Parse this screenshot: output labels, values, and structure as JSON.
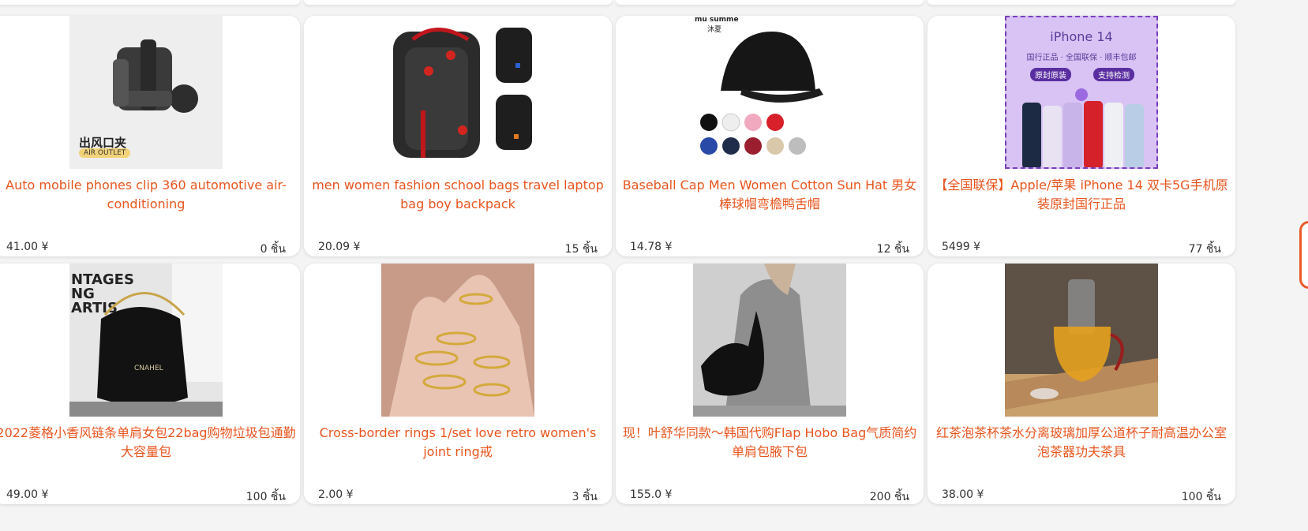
{
  "products": [
    {
      "title": "Auto mobile phones clip 360 automotive air-conditioning",
      "price": "41.00 ¥",
      "qty": "0 ชิ้น",
      "image": {
        "overlay": "出风口夹",
        "badge": "AIR OUTLET"
      }
    },
    {
      "title": "men women fashion school bags travel laptop bag boy backpack",
      "price": "20.09 ¥",
      "qty": "15 ชิ้น",
      "image": {}
    },
    {
      "title": "Baseball Cap Men Women Cotton Sun Hat 男女棒球帽弯檐鸭舌帽",
      "price": "14.78 ¥",
      "qty": "12 ชิ้น",
      "image": {
        "corner_text": "mu summe",
        "corner_sub": "沐夏"
      }
    },
    {
      "title": "【全国联保】Apple/苹果 iPhone 14 双卡5G手机原装原封国行正品",
      "price": "5499 ¥",
      "qty": "77 ชิ้น",
      "image": {
        "heading": "iPhone 14",
        "tagline": "国行正品 · 全国联保 · 顺丰包邮",
        "badge1": "原封原装",
        "badge2": "支持检测"
      }
    },
    {
      "title": "2022菱格小香风链条单肩女包22bag购物垃圾包通勤大容量包",
      "price": "49.00 ¥",
      "qty": "100 ชิ้น",
      "image": {
        "wall_text": "NTAGES NG ARTIS",
        "bag_text": "CNAHEL"
      }
    },
    {
      "title": "Cross-border rings 1/set love retro women's joint ring戒",
      "price": "2.00 ¥",
      "qty": "3 ชิ้น",
      "image": {}
    },
    {
      "title": "现！叶舒华同款～韩国代购Flap Hobo Bag气质简约单肩包腋下包",
      "price": "155.0 ¥",
      "qty": "200 ชิ้น",
      "image": {}
    },
    {
      "title": "红茶泡茶杯茶水分离玻璃加厚公道杯子耐高温办公室泡茶器功夫茶具",
      "price": "38.00 ¥",
      "qty": "100 ชิ้น",
      "image": {}
    }
  ],
  "colors": {
    "title": "#e8551e",
    "background": "#f4f4f4",
    "card": "#ffffff"
  }
}
